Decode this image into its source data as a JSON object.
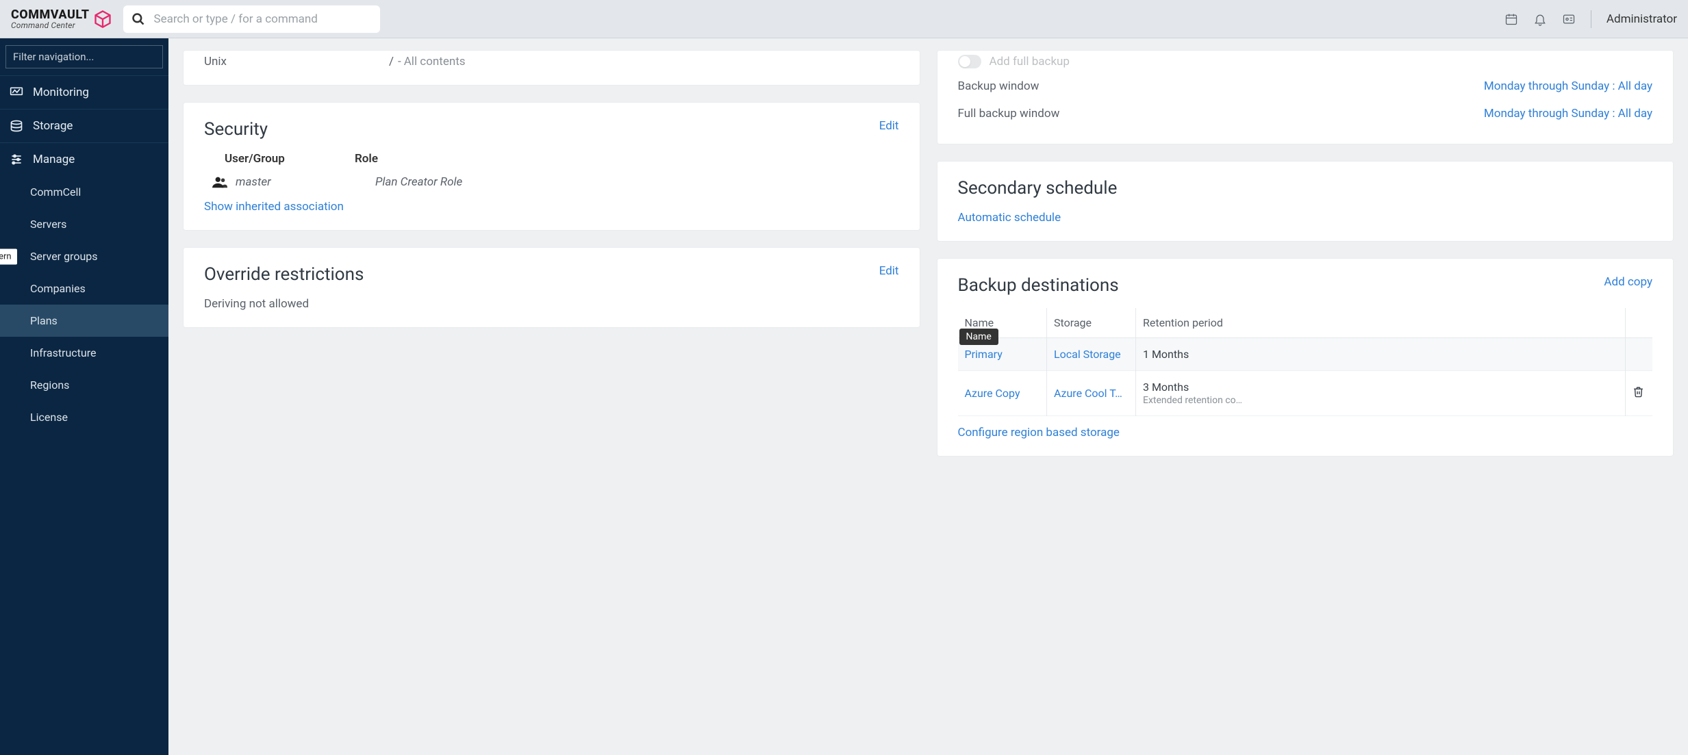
{
  "header": {
    "brand_main": "COMMVAULT",
    "brand_sub": "Command Center",
    "search_placeholder": "Search or type / for a command",
    "user": "Administrator"
  },
  "sidebar": {
    "filter_placeholder": "Filter navigation...",
    "top": [
      {
        "label": "Monitoring",
        "icon": "monitor"
      },
      {
        "label": "Storage",
        "icon": "storage"
      },
      {
        "label": "Manage",
        "icon": "sliders"
      }
    ],
    "manage_children": [
      {
        "label": "CommCell"
      },
      {
        "label": "Servers"
      },
      {
        "label": "Server groups",
        "badge": "Modern"
      },
      {
        "label": "Companies"
      },
      {
        "label": "Plans",
        "active": true
      },
      {
        "label": "Infrastructure"
      },
      {
        "label": "Regions"
      },
      {
        "label": "License"
      }
    ]
  },
  "unix": {
    "label": "Unix",
    "path": "/",
    "dash": "-",
    "content": "All contents"
  },
  "security": {
    "title": "Security",
    "edit": "Edit",
    "col_user": "User/Group",
    "col_role": "Role",
    "user": "master",
    "role": "Plan Creator Role",
    "show_inherited": "Show inherited association"
  },
  "override": {
    "title": "Override restrictions",
    "edit": "Edit",
    "text": "Deriving not allowed"
  },
  "rpo": {
    "add_full": "Add full backup",
    "window_label": "Backup window",
    "window_value": "Monday through Sunday : All day",
    "full_window_label": "Full backup window",
    "full_window_value": "Monday through Sunday : All day"
  },
  "secondary": {
    "title": "Secondary schedule",
    "link": "Automatic schedule"
  },
  "destinations": {
    "title": "Backup destinations",
    "add_copy": "Add copy",
    "cols": {
      "name": "Name",
      "storage": "Storage",
      "retention": "Retention period"
    },
    "tooltip": "Name",
    "rows": [
      {
        "name": "Primary",
        "storage": "Local Storage",
        "retention": "1 Months",
        "retention_sub": "",
        "deletable": false
      },
      {
        "name": "Azure Copy",
        "storage": "Azure Cool T…",
        "retention": "3 Months",
        "retention_sub": "Extended retention co…",
        "deletable": true
      }
    ],
    "region_link": "Configure region based storage"
  }
}
